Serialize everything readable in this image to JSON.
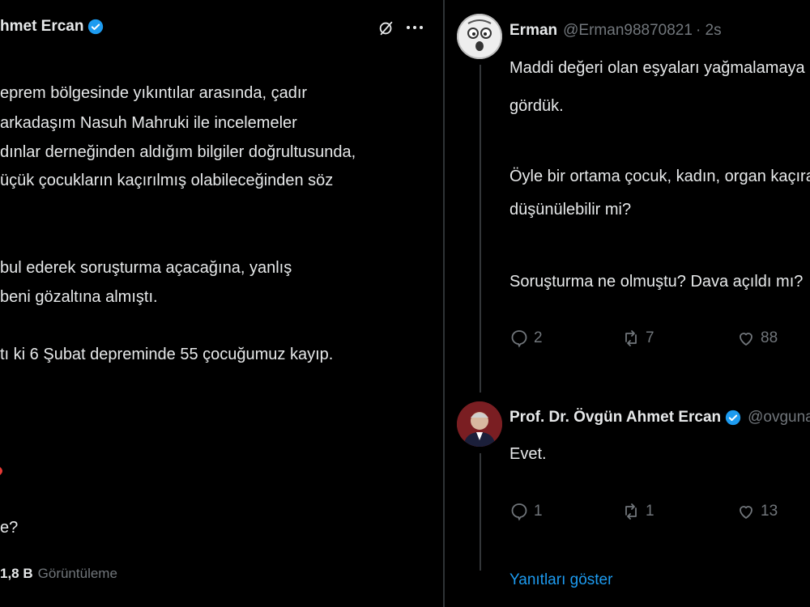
{
  "left": {
    "author_name": "hmet Ercan",
    "lines": [
      "eprem bölgesinde yıkıntılar arasında, çadır",
      "arkadaşım Nasuh Mahruki ile incelemeler",
      "dınlar derneğinden aldığım bilgiler doğrultusunda,",
      "üçük çocukların kaçırılmış olabileceğinden söz",
      "bul ederek soruşturma açacağına, yanlış",
      "beni gözaltına almıştı.",
      "tı ki 6 Şubat depreminde 55 çocuğumuz kayıp.",
      "e?"
    ],
    "views_count": "1,8 B",
    "views_label": "Görüntüleme"
  },
  "right": {
    "tweet1": {
      "name": "Erman",
      "handle": "@Erman98870821",
      "time": "· 2s",
      "lines": [
        "Maddi değeri olan eşyaları yağmalamaya ne k",
        "gördük.",
        "Öyle bir ortama çocuk, kadın, organ kaçıran ş",
        "düşünülebilir mi?",
        "Soruşturma ne olmuştu? Dava açıldı mı?"
      ],
      "replies": "2",
      "retweets": "7",
      "likes": "88"
    },
    "tweet2": {
      "name": "Prof. Dr. Övgün Ahmet Ercan",
      "handle": "@ovgunaerc",
      "text": "Evet.",
      "replies": "1",
      "retweets": "1",
      "likes": "13"
    },
    "show_replies": "Yanıtları göster"
  },
  "colors": {
    "background": "#000000",
    "text": "#e7e9ea",
    "muted": "#71767b",
    "accent": "#1d9bf0"
  },
  "icons": [
    "verified-badge-icon",
    "grok-icon",
    "more-icon",
    "reply-icon",
    "retweet-icon",
    "like-icon"
  ]
}
